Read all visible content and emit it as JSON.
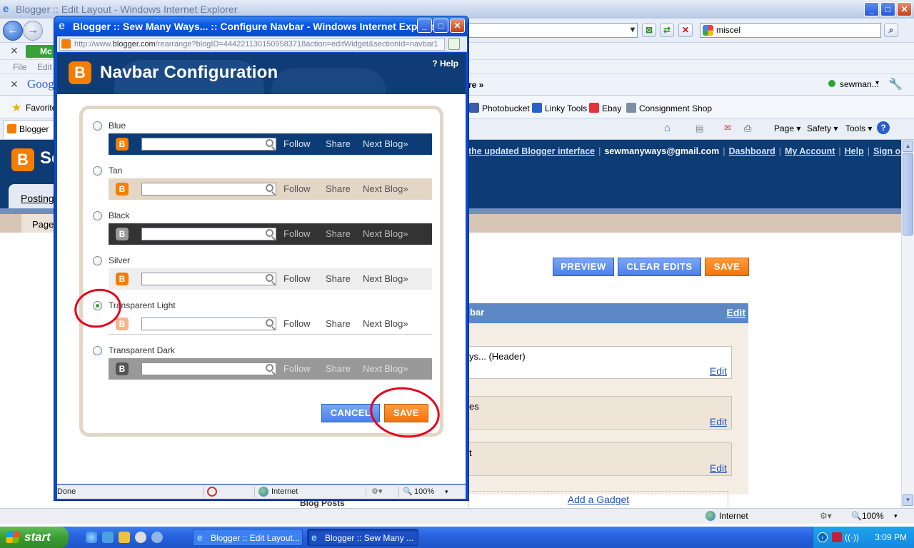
{
  "background_window": {
    "title": "Blogger :: Edit Layout - Windows Internet Explorer",
    "search_value": "miscel",
    "menu_items": [
      "File",
      "Edit"
    ],
    "toolbar_left": "Mc",
    "google_label": "Goog",
    "more_label": "re »",
    "account_label": "sewman...",
    "favorites_label": "Favorite",
    "tab_label": "Blogger ::",
    "favorites": [
      {
        "label": "Photobucket",
        "icon": "photobucket-icon",
        "color": "#3b5ca8"
      },
      {
        "label": "Linky Tools",
        "icon": "linky-tools-icon",
        "color": "#2a61c7"
      },
      {
        "label": "Ebay",
        "icon": "ebay-icon",
        "color": "#e53238"
      },
      {
        "label": "Consignment Shop",
        "icon": "page-icon",
        "color": "#7c8ea6"
      }
    ],
    "command_bar": [
      "Page ▾",
      "Safety ▾",
      "Tools ▾"
    ],
    "blogger": {
      "logo_letter": "B",
      "logo_partial_text": "Se",
      "updated_link": "the updated Blogger interface",
      "email": "sewmanyways@gmail.com",
      "links": [
        "Dashboard",
        "My Account",
        "Help",
        "Sign out"
      ],
      "posting_tab": "Posting",
      "page_tab": "Page",
      "buttons": {
        "preview": "PREVIEW",
        "clear": "CLEAR EDITS",
        "save": "SAVE"
      },
      "navbar_head": "bar",
      "edit_label": "Edit",
      "gadgets": [
        "ys... (Header)",
        "es",
        "t"
      ],
      "add_gadget": "Add a Gadget",
      "blog_posts": "Blog Posts"
    },
    "status": {
      "zone": "Internet",
      "zoom": "100%"
    }
  },
  "popup": {
    "title": "Blogger :: Sew Many Ways... :: Configure Navbar - Windows Internet Explorer",
    "url_prefix": "http://www.",
    "url_domain": "blogger.com",
    "url_rest": "/rearrange?blogID=4442211301505583718action=editWidget&sectionId=navbar1",
    "header_title": "Navbar Configuration",
    "help_label": "? Help",
    "options": [
      {
        "label": "Blue",
        "bg": "#0d3b74",
        "text": "#d9e4f3",
        "logo": "#f57d00",
        "checked": false
      },
      {
        "label": "Tan",
        "bg": "#e3d6c5",
        "text": "#555555",
        "logo": "#f57d00",
        "checked": false
      },
      {
        "label": "Black",
        "bg": "#333333",
        "text": "#bbbbbb",
        "logo": "#999999",
        "checked": false
      },
      {
        "label": "Silver",
        "bg": "#eeeeee",
        "text": "#444444",
        "logo": "#f57d00",
        "checked": false
      },
      {
        "label": "Transparent Light",
        "bg": "#ffffff",
        "text": "#444444",
        "logo": "#f7b58a",
        "checked": true
      },
      {
        "label": "Transparent Dark",
        "bg": "#999999",
        "text": "#dddddd",
        "logo": "#555555",
        "checked": false
      }
    ],
    "navbar_links": {
      "follow": "Follow",
      "share": "Share",
      "next": "Next Blog»"
    },
    "cancel_label": "CANCEL",
    "save_label": "SAVE",
    "status": {
      "left": "Done",
      "zone": "Internet",
      "zoom": "100%"
    }
  },
  "taskbar": {
    "start_label": "start",
    "tasks": [
      "Blogger :: Edit Layout...",
      "Blogger :: Sew Many ..."
    ],
    "clock": "3:09 PM"
  }
}
